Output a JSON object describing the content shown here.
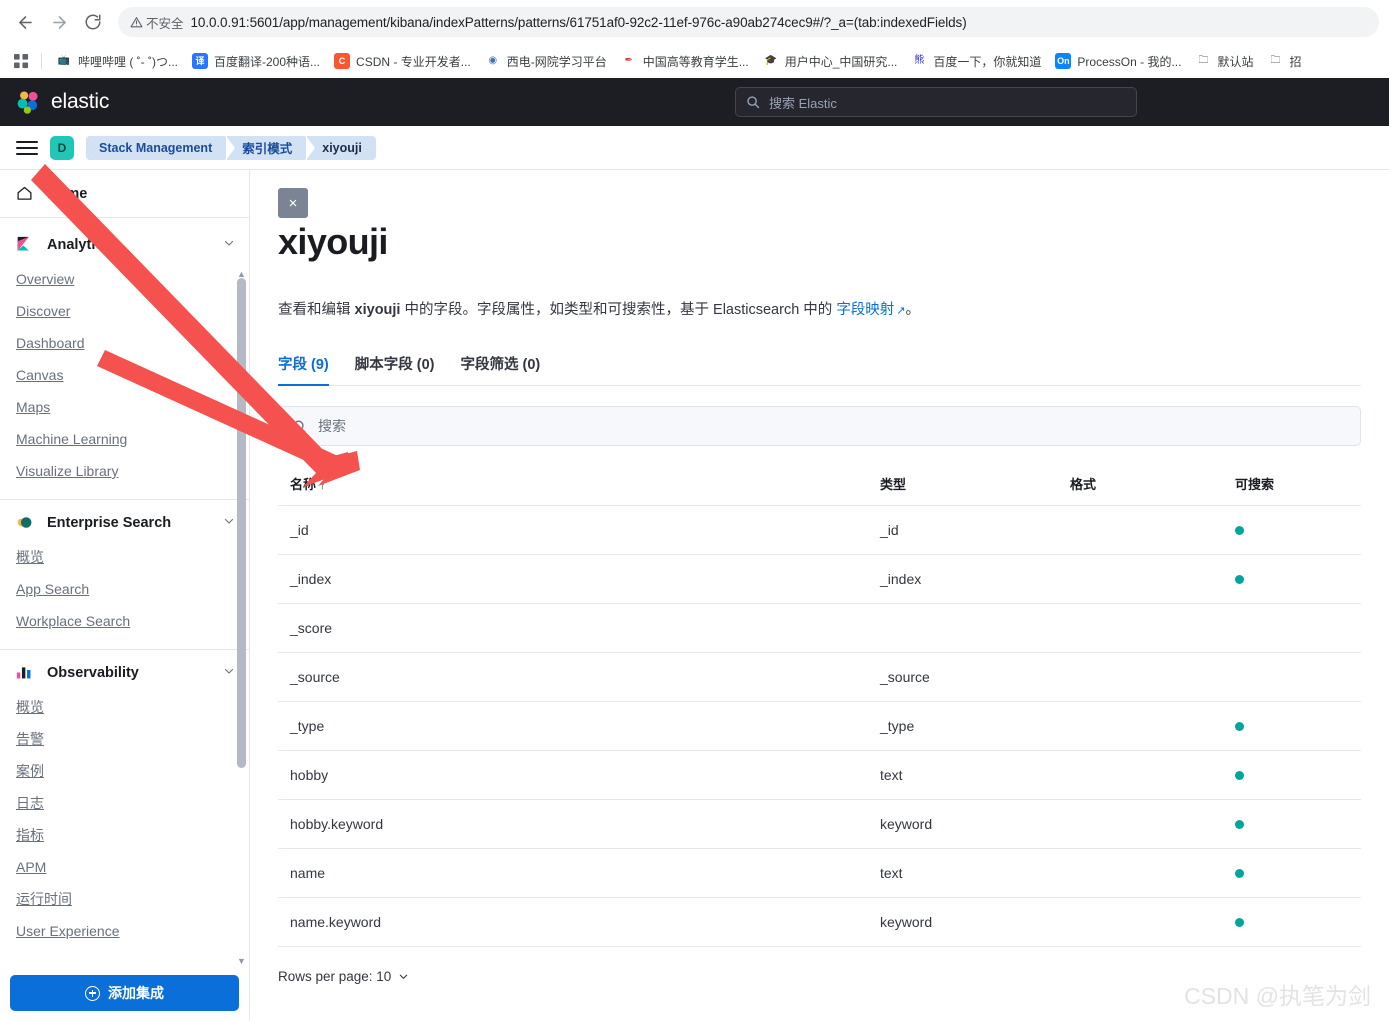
{
  "browser": {
    "nav": {
      "back_label": "back",
      "forward_label": "forward",
      "reload_label": "reload"
    },
    "security_label": "不安全",
    "url": "10.0.0.91:5601/app/management/kibana/indexPatterns/patterns/61751af0-92c2-11ef-976c-a90ab274cec9#/?_a=(tab:indexedFields)",
    "bookmarks": [
      {
        "label": "哔哩哔哩 ( ˚- ˚)つ...",
        "icon": "bilibili-icon",
        "icon_glyph": "📺",
        "color": "#00a1d6"
      },
      {
        "label": "百度翻译-200种语...",
        "icon": "baidu-translate-icon",
        "icon_glyph": "译",
        "color": "#2878ff"
      },
      {
        "label": "CSDN - 专业开发者...",
        "icon": "csdn-icon",
        "icon_glyph": "C",
        "color": "#fc5531"
      },
      {
        "label": "西电-网院学习平台",
        "icon": "xidian-icon",
        "icon_glyph": "◉",
        "color": "#3f6fb5"
      },
      {
        "label": "中国高等教育学生...",
        "icon": "chsi-icon",
        "icon_glyph": "✒",
        "color": "#d33b2c"
      },
      {
        "label": "用户中心_中国研究...",
        "icon": "graduation-cap-icon",
        "icon_glyph": "🎓",
        "color": "#2b2b2b"
      },
      {
        "label": "百度一下，你就知道",
        "icon": "baidu-icon",
        "icon_glyph": "熊",
        "color": "#2932e1"
      },
      {
        "label": "ProcessOn - 我的...",
        "icon": "processon-icon",
        "icon_glyph": "On",
        "color": "#0a84ff"
      },
      {
        "label": "默认站",
        "icon": "folder-icon",
        "icon_glyph": "🗀",
        "color": "#5f6368"
      },
      {
        "label": "招",
        "icon": "folder-icon",
        "icon_glyph": "🗀",
        "color": "#5f6368"
      }
    ]
  },
  "elastic_header": {
    "brand": "elastic",
    "search_placeholder": "搜索 Elastic"
  },
  "breadcrumbs": {
    "avatar_initial": "D",
    "items": [
      {
        "label": "Stack Management"
      },
      {
        "label": "索引模式"
      },
      {
        "label": "xiyouji"
      }
    ]
  },
  "sidebar": {
    "home": {
      "label": "Home",
      "icon": "home-icon"
    },
    "groups": [
      {
        "title": "Analytics",
        "icon": "kibana-logo-icon",
        "expanded": true,
        "items": [
          {
            "label": "Overview"
          },
          {
            "label": "Discover"
          },
          {
            "label": "Dashboard"
          },
          {
            "label": "Canvas"
          },
          {
            "label": "Maps"
          },
          {
            "label": "Machine Learning"
          },
          {
            "label": "Visualize Library"
          }
        ]
      },
      {
        "title": "Enterprise Search",
        "icon": "enterprise-search-logo-icon",
        "expanded": true,
        "items": [
          {
            "label": "概览"
          },
          {
            "label": "App Search"
          },
          {
            "label": "Workplace Search"
          }
        ]
      },
      {
        "title": "Observability",
        "icon": "observability-logo-icon",
        "expanded": true,
        "items": [
          {
            "label": "概览"
          },
          {
            "label": "告警"
          },
          {
            "label": "案例"
          },
          {
            "label": "日志"
          },
          {
            "label": "指标"
          },
          {
            "label": "APM"
          },
          {
            "label": "运行时间"
          },
          {
            "label": "User Experience"
          }
        ]
      }
    ],
    "add_integration_label": "添加集成"
  },
  "main": {
    "close_label": "×",
    "title": "xiyouji",
    "description": {
      "part1": "查看和编辑 ",
      "bold1": "xiyouji",
      "part2": " 中的字段。字段属性，如类型和可搜索性，基于 Elasticsearch 中的 ",
      "link": "字段映射",
      "part3": "。"
    },
    "tabs": [
      {
        "label": "字段 (9)",
        "active": true
      },
      {
        "label": "脚本字段 (0)",
        "active": false
      },
      {
        "label": "字段筛选 (0)",
        "active": false
      }
    ],
    "search_placeholder": "搜索",
    "table": {
      "columns": [
        {
          "label": "名称",
          "sorted": true,
          "sort_arrow": "↑"
        },
        {
          "label": "类型"
        },
        {
          "label": "格式"
        },
        {
          "label": "可搜索"
        }
      ],
      "rows": [
        {
          "name": "_id",
          "type": "_id",
          "format": "",
          "searchable": true
        },
        {
          "name": "_index",
          "type": "_index",
          "format": "",
          "searchable": true
        },
        {
          "name": "_score",
          "type": "",
          "format": "",
          "searchable": false
        },
        {
          "name": "_source",
          "type": "_source",
          "format": "",
          "searchable": false
        },
        {
          "name": "_type",
          "type": "_type",
          "format": "",
          "searchable": true
        },
        {
          "name": "hobby",
          "type": "text",
          "format": "",
          "searchable": true
        },
        {
          "name": "hobby.keyword",
          "type": "keyword",
          "format": "",
          "searchable": true
        },
        {
          "name": "name",
          "type": "text",
          "format": "",
          "searchable": true
        },
        {
          "name": "name.keyword",
          "type": "keyword",
          "format": "",
          "searchable": true
        }
      ]
    },
    "rows_per_page_label": "Rows per page: 10"
  },
  "watermark": "CSDN @执笔为剑",
  "colors": {
    "accent_blue": "#0a6fd8",
    "searchable_dot": "#00a69b",
    "avatar_teal": "#20c7b7",
    "crumb_bg": "#d3e1f5",
    "annotation_red": "#f4514f"
  }
}
